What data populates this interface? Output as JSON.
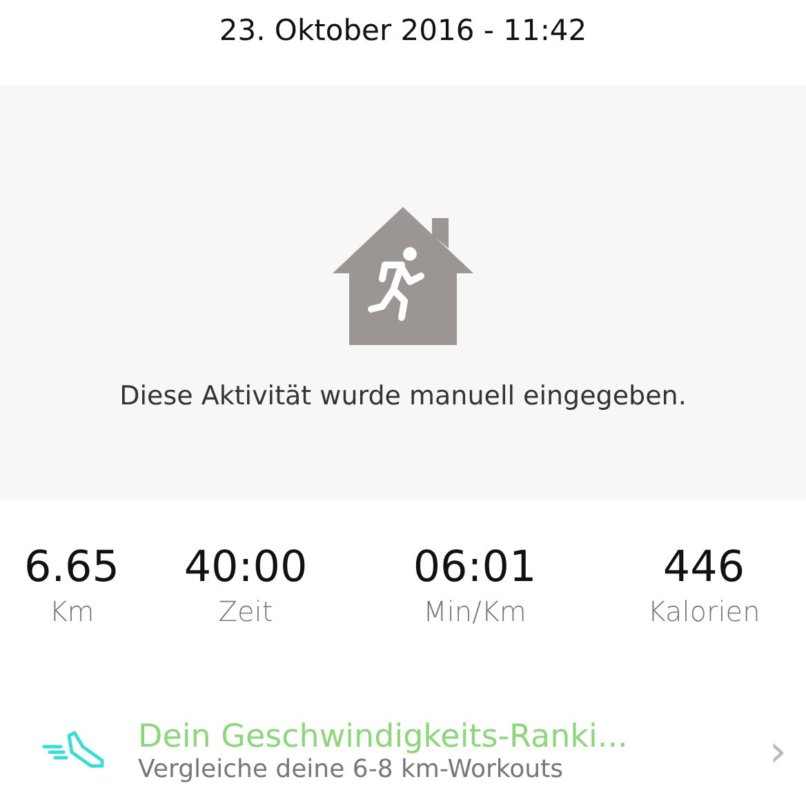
{
  "header": {
    "date": "23. Oktober 2016 - 11:42"
  },
  "activity": {
    "message": "Diese Aktivität wurde manuell eingegeben."
  },
  "stats": [
    {
      "value": "6.65",
      "label": "Km"
    },
    {
      "value": "40:00",
      "label": "Zeit"
    },
    {
      "value": "06:01",
      "label": "Min/Km"
    },
    {
      "value": "446",
      "label": "Kalorien"
    }
  ],
  "ranking": {
    "title": "Dein Geschwindigkeits-Ranki...",
    "subtitle": "Vergleiche deine 6-8 km-Workouts",
    "chevron": "›"
  }
}
